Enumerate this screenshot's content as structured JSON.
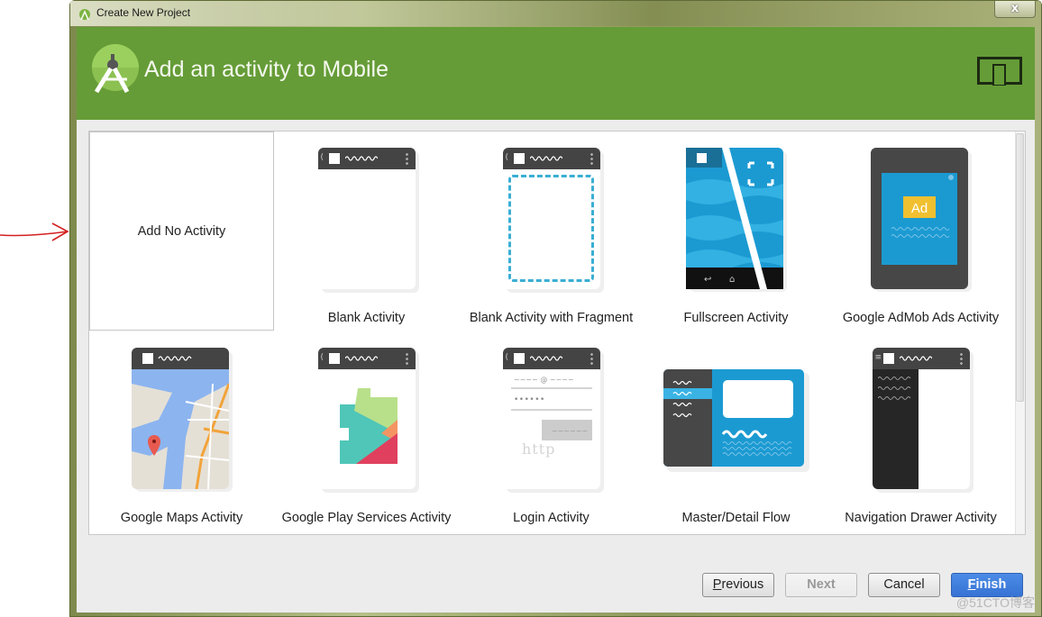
{
  "window": {
    "title": "Create New Project",
    "close_label": "x"
  },
  "header": {
    "title": "Add an activity to Mobile",
    "form_factor_icon": "phone-tablet-icon",
    "color": "#659c37"
  },
  "gallery": {
    "items": [
      {
        "label": "Add No Activity",
        "icon": "none"
      },
      {
        "label": "Blank Activity",
        "icon": "blank-activity-thumbnail"
      },
      {
        "label": "Blank Activity with Fragment",
        "icon": "blank-fragment-thumbnail"
      },
      {
        "label": "Fullscreen Activity",
        "icon": "fullscreen-thumbnail"
      },
      {
        "label": "Google AdMob Ads Activity",
        "icon": "admob-thumbnail",
        "ad_badge": "Ad"
      },
      {
        "label": "Google Maps Activity",
        "icon": "maps-thumbnail"
      },
      {
        "label": "Google Play Services Activity",
        "icon": "play-services-thumbnail"
      },
      {
        "label": "Login Activity",
        "icon": "login-thumbnail"
      },
      {
        "label": "Master/Detail Flow",
        "icon": "master-detail-thumbnail"
      },
      {
        "label": "Navigation Drawer Activity",
        "icon": "nav-drawer-thumbnail"
      }
    ]
  },
  "buttons": {
    "previous": {
      "mnemonic": "P",
      "rest": "revious"
    },
    "next": "Next",
    "cancel": "Cancel",
    "finish": {
      "mnemonic": "F",
      "rest": "inish"
    }
  },
  "watermarks": {
    "url_overlay": "http",
    "corner": "@51CTO博客"
  },
  "colors": {
    "accent_blue": "#3a78d8",
    "fragment_dash": "#3aaed3",
    "ad_yellow": "#f0c030"
  }
}
